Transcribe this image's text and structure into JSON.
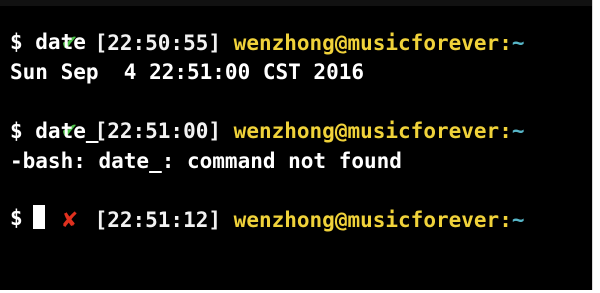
{
  "terminal": {
    "lines": [
      {
        "type": "prompt",
        "status": "ok",
        "status_icon": "✔",
        "time": "[22:50:55]",
        "user_host": "wenzhong@musicforever",
        "sep": ":",
        "path": "~"
      },
      {
        "type": "cmd",
        "text": "$ date"
      },
      {
        "type": "output",
        "text": "Sun Sep  4 22:51:00 CST 2016"
      },
      {
        "type": "prompt",
        "status": "ok",
        "status_icon": "✔",
        "time": "[22:51:00]",
        "user_host": "wenzhong@musicforever",
        "sep": ":",
        "path": "~"
      },
      {
        "type": "cmd",
        "text": "$ date_"
      },
      {
        "type": "output",
        "text": "-bash: date_: command not found"
      },
      {
        "type": "prompt",
        "status": "err",
        "status_icon": "✘",
        "time": "[22:51:12]",
        "user_host": "wenzhong@musicforever",
        "sep": ":",
        "path": "~"
      },
      {
        "type": "cmd",
        "text": "$"
      }
    ]
  },
  "colors": {
    "background": "#000000",
    "ok": "#4ec24a",
    "error": "#e0301e",
    "user_host": "#f0d23a",
    "path": "#57b6c8"
  }
}
